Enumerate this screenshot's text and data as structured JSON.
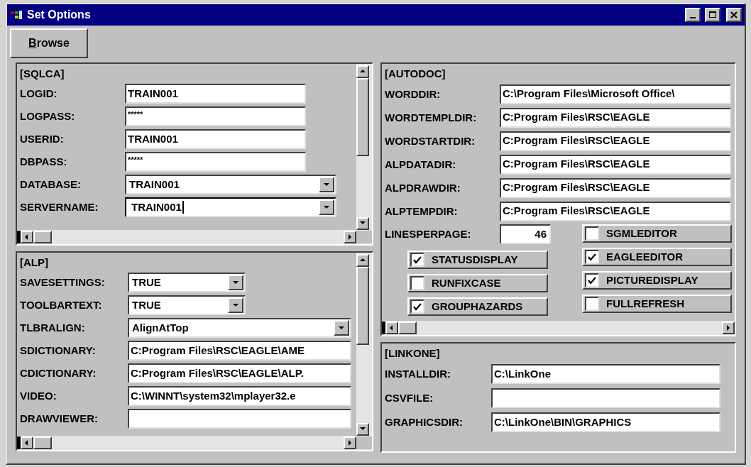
{
  "window": {
    "title": "Set Options"
  },
  "browse_button": "Browse",
  "left_panels": [
    {
      "heading": "[SQLCA]",
      "fields": [
        {
          "label": "LOGID:",
          "value": "TRAIN001",
          "kind": "text"
        },
        {
          "label": "LOGPASS:",
          "value": "*****",
          "kind": "password"
        },
        {
          "label": "USERID:",
          "value": "TRAIN001",
          "kind": "text"
        },
        {
          "label": "DBPASS:",
          "value": "*****",
          "kind": "password"
        },
        {
          "label": "DATABASE:",
          "value": "TRAIN001",
          "kind": "dropdown",
          "focused": false
        },
        {
          "label": "SERVERNAME:",
          "value": "TRAIN001",
          "kind": "dropdown",
          "focused": true
        }
      ]
    },
    {
      "heading": "[ALP]",
      "fields": [
        {
          "label": "SAVESETTINGS:",
          "value": "TRUE",
          "kind": "small-dropdown",
          "focused": false
        },
        {
          "label": "TOOLBARTEXT:",
          "value": "TRUE",
          "kind": "small-dropdown",
          "focused": false
        },
        {
          "label": "TLBRALIGN:",
          "value": "AlignAtTop",
          "kind": "dropdown",
          "focused": false
        },
        {
          "label": "SDICTIONARY:",
          "value": "C:Program Files\\RSC\\EAGLE\\AME",
          "kind": "text"
        },
        {
          "label": "CDICTIONARY:",
          "value": "C:Program Files\\RSC\\EAGLE\\ALP.",
          "kind": "text"
        },
        {
          "label": "VIDEO:",
          "value": "C:\\WINNT\\system32\\mplayer32.e",
          "kind": "text"
        },
        {
          "label": "DRAWVIEWER:",
          "kind": "text"
        }
      ]
    }
  ],
  "right_panels": [
    {
      "heading": "[AUTODOC]",
      "fields": [
        {
          "label": "WORDDIR:",
          "value": "C:\\Program Files\\Microsoft Office\\",
          "kind": "text"
        },
        {
          "label": "WORDTEMPLDIR:",
          "value": "C:Program Files\\RSC\\EAGLE",
          "kind": "text"
        },
        {
          "label": "WORDSTARTDIR:",
          "value": "C:Program Files\\RSC\\EAGLE",
          "kind": "text"
        },
        {
          "label": "ALPDATADIR:",
          "value": "C:Program Files\\RSC\\EAGLE",
          "kind": "text"
        },
        {
          "label": "ALPDRAWDIR:",
          "value": "C:Program Files\\RSC\\EAGLE",
          "kind": "text"
        },
        {
          "label": "ALPTEMPDIR:",
          "value": "C:Program Files\\RSC\\EAGLE",
          "kind": "text"
        }
      ],
      "number_field": {
        "label": "LINESPERPAGE:",
        "value": "46"
      },
      "checks_left": [
        {
          "label": "STATUSDISPLAY",
          "checked": true
        },
        {
          "label": "RUNFIXCASE",
          "checked": false
        },
        {
          "label": "GROUPHAZARDS",
          "checked": true
        }
      ],
      "checks_right": [
        {
          "label": "SGMLEDITOR",
          "checked": false
        },
        {
          "label": "EAGLEEDITOR",
          "checked": true
        },
        {
          "label": "PICTUREDISPLAY",
          "checked": true
        },
        {
          "label": "FULLREFRESH",
          "checked": false
        }
      ]
    },
    {
      "heading": "[LINKONE]",
      "fields": [
        {
          "label": "INSTALLDIR:",
          "value": "C:\\LinkOne",
          "kind": "text"
        },
        {
          "label": "CSVFILE:",
          "kind": "text"
        },
        {
          "label": "GRAPHICSDIR:",
          "value": "C:\\LinkOne\\BIN\\GRAPHICS",
          "kind": "text"
        }
      ]
    }
  ]
}
